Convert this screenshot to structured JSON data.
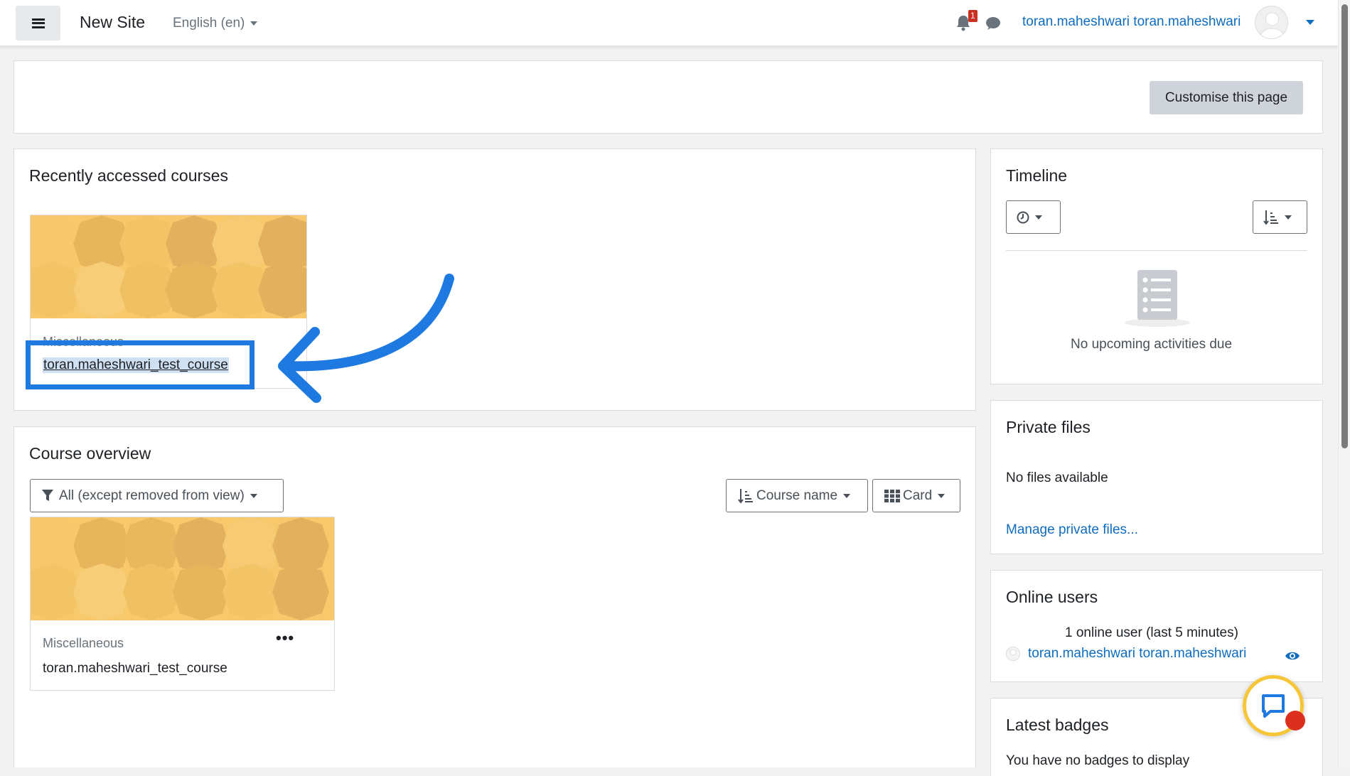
{
  "navbar": {
    "site_name": "New Site",
    "language": "English (en)",
    "notification_count": "1",
    "user_name": "toran.maheshwari toran.maheshwari"
  },
  "customise": {
    "label": "Customise this page"
  },
  "recent": {
    "title": "Recently accessed courses",
    "course": {
      "category": "Miscellaneous",
      "name": "toran.maheshwari_test_course"
    }
  },
  "overview": {
    "title": "Course overview",
    "filter_label": "All (except removed from view)",
    "sort_label": "Course name",
    "view_label": "Card",
    "course": {
      "category": "Miscellaneous",
      "name": "toran.maheshwari_test_course"
    }
  },
  "timeline": {
    "title": "Timeline",
    "empty": "No upcoming activities due"
  },
  "private_files": {
    "title": "Private files",
    "empty": "No files available",
    "manage_link": "Manage private files..."
  },
  "online_users": {
    "title": "Online users",
    "summary": "1 online user (last 5 minutes)",
    "user": "toran.maheshwari toran.maheshwari"
  },
  "badges": {
    "title": "Latest badges",
    "empty": "You have no badges to display"
  },
  "colors": {
    "brand": "#0f6cbf",
    "highlight": "#1e7ae0",
    "course_pattern": "#f7c96a"
  }
}
